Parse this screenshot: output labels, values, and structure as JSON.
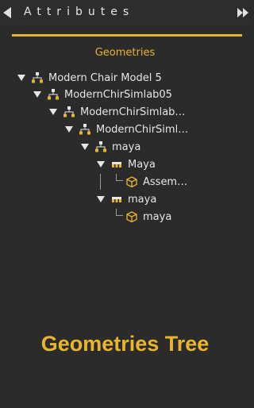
{
  "header": {
    "title": "Attributes"
  },
  "section_title": "Geometries",
  "tree": {
    "nodes": [
      {
        "label": "Modern Chair Model 5",
        "icon": "hierarchy-icon"
      },
      {
        "label": "ModernChirSimlab05",
        "icon": "hierarchy-icon"
      },
      {
        "label": "ModernChirSimlab…",
        "icon": "hierarchy-icon"
      },
      {
        "label": "ModernChirSiml…",
        "icon": "hierarchy-icon"
      },
      {
        "label": "maya",
        "icon": "hierarchy-icon"
      },
      {
        "label": "Maya",
        "icon": "group-icon"
      },
      {
        "label": "Assem…",
        "icon": "cube-icon"
      },
      {
        "label": "maya",
        "icon": "group-icon"
      },
      {
        "label": "maya",
        "icon": "cube-icon"
      }
    ]
  },
  "caption": "Geometries Tree",
  "colors": {
    "accent": "#e8b52d",
    "background": "#2b2b2b",
    "text": "#e6e6e6"
  }
}
